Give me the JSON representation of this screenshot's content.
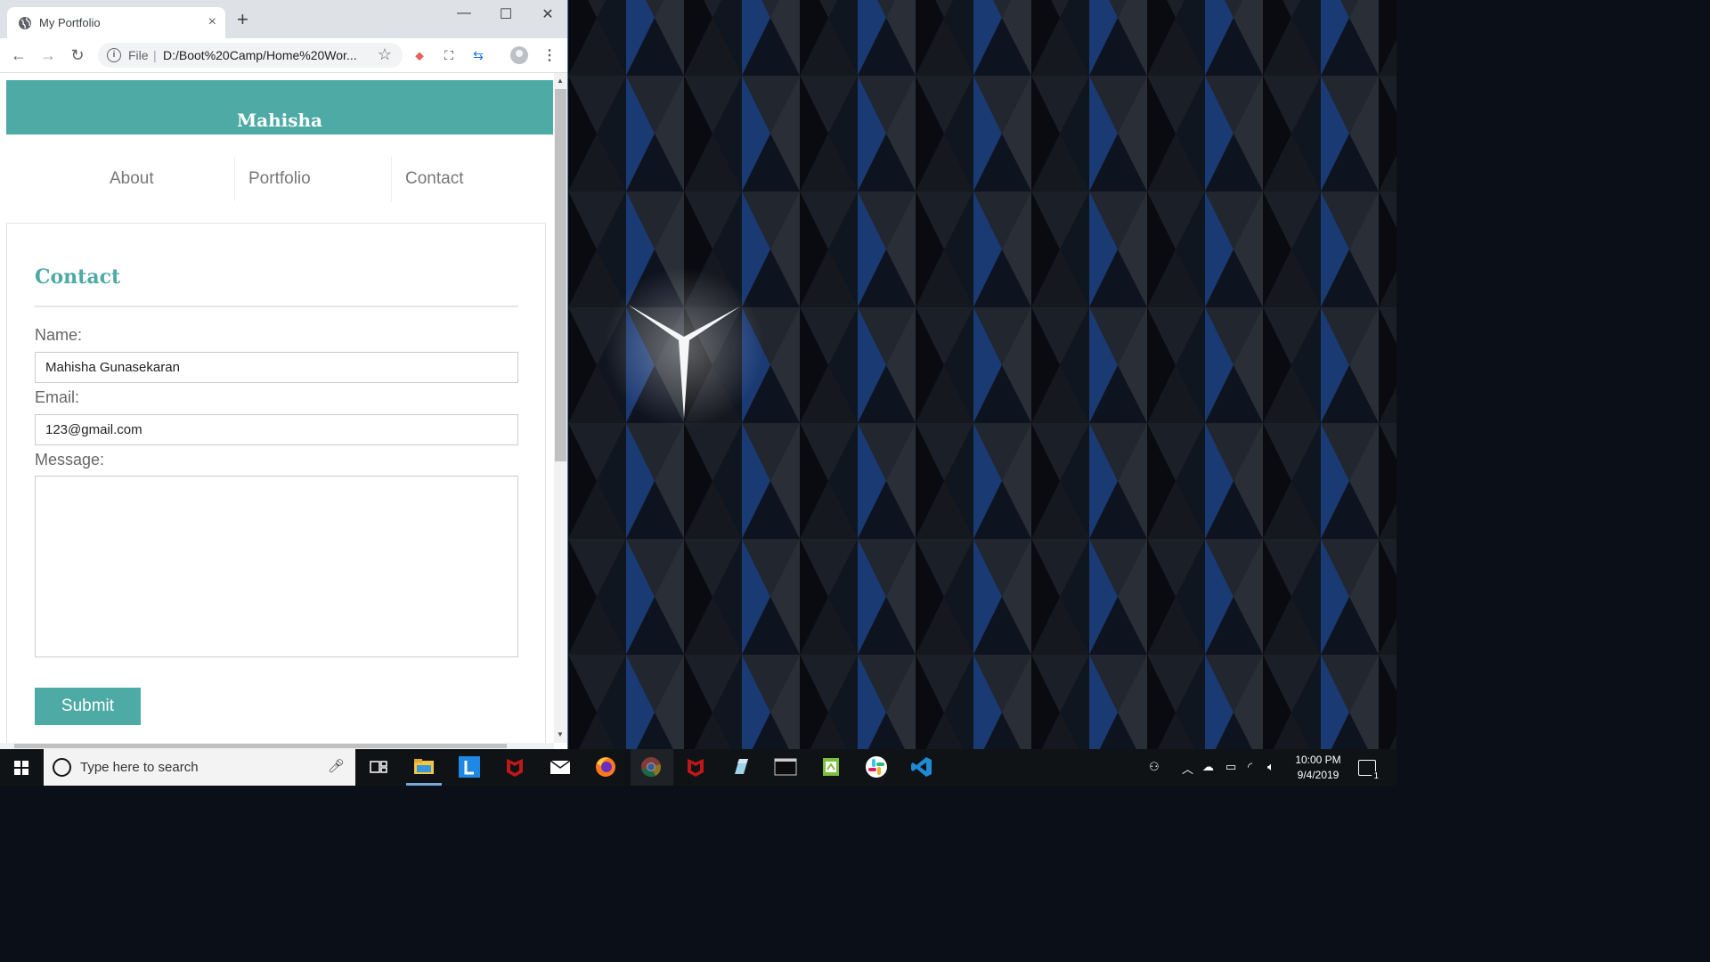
{
  "browser": {
    "tab_title": "My Portfolio",
    "tab_close": "×",
    "new_tab": "+",
    "window_controls": {
      "minimize": "—",
      "maximize": "☐",
      "close": "✕"
    },
    "nav": {
      "back": "←",
      "forward": "→",
      "reload": "↻"
    },
    "omnibox": {
      "scheme": "File",
      "separator": "|",
      "url": "D:/Boot%20Camp/Home%20Wor..."
    },
    "star": "☆",
    "menu": "⋮"
  },
  "site": {
    "name": "Mahisha",
    "nav": [
      "About",
      "Portfolio",
      "Contact"
    ],
    "contact": {
      "title": "Contact",
      "name_label": "Name:",
      "name_value": "Mahisha Gunasekaran",
      "email_label": "Email:",
      "email_value": "123@gmail.com",
      "message_label": "Message:",
      "message_value": "",
      "submit_label": "Submit"
    },
    "colors": {
      "accent": "#4eaaa4"
    }
  },
  "taskbar": {
    "search_placeholder": "Type here to search",
    "icons": [
      "windows-start-icon",
      "cortana-icon",
      "microphone-icon",
      "task-view-icon",
      "file-explorer-icon",
      "lenovo-vantage-icon",
      "mcafee-icon",
      "mail-icon",
      "firefox-icon",
      "chrome-icon",
      "mcafee-livesafe-icon",
      "notepad-icon",
      "terminal-icon",
      "sticky-notes-icon",
      "slack-icon",
      "vscode-icon"
    ],
    "clock_time": "10:00 PM",
    "clock_date": "9/4/2019",
    "notification_count": "1"
  }
}
